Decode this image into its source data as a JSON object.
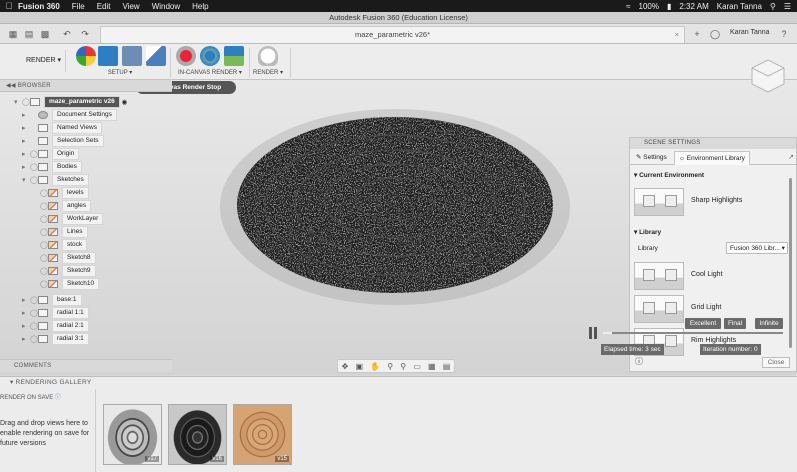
{
  "menubar": {
    "app_name": "Fusion 360",
    "items": [
      "File",
      "Edit",
      "View",
      "Window",
      "Help"
    ],
    "battery": "100%",
    "time": "2:32 AM",
    "user": "Karan Tanna"
  },
  "window_title": "Autodesk Fusion 360 (Education License)",
  "tabbar": {
    "doc_tab": "maze_parametric v26*",
    "user": "Karan Tanna"
  },
  "toolbar": {
    "workspace": "RENDER",
    "groups": [
      "SETUP",
      "IN-CANVAS RENDER",
      "RENDER"
    ]
  },
  "tooltip": "In-canvas Render Stop",
  "browser": {
    "title": "BROWSER",
    "root": "maze_parametric v26",
    "items": [
      {
        "label": "Document Settings",
        "icon": "gear-icon"
      },
      {
        "label": "Named Views",
        "icon": "folder-icon"
      },
      {
        "label": "Selection Sets",
        "icon": "folder-icon"
      },
      {
        "label": "Origin",
        "icon": "folder-icon"
      },
      {
        "label": "Bodies",
        "icon": "folder-icon"
      },
      {
        "label": "Sketches",
        "icon": "folder-icon"
      }
    ],
    "sketches": [
      "levels",
      "angles",
      "WorkLayer",
      "Lines",
      "stock",
      "Sketch8",
      "Sketch9",
      "Sketch10"
    ],
    "components": [
      "base:1",
      "radial 1:1",
      "radial 2:1",
      "radial 3:1"
    ]
  },
  "comments": "COMMENTS",
  "scene": {
    "title": "SCENE SETTINGS",
    "tabs": [
      "Settings",
      "Environment Library"
    ],
    "current_env_heading": "Current Environment",
    "current_env": "Sharp Highlights",
    "library_heading": "Library",
    "library_label": "Library",
    "library_value": "Fusion 360 Libr...",
    "environments": [
      "Cool Light",
      "Grid Light",
      "Rim Highlights"
    ],
    "close_label": "Close"
  },
  "render_progress": {
    "quality_levels": [
      "Excellent",
      "Final",
      "Infinite"
    ],
    "progress_fraction": 0.05,
    "elapsed": "Elapsed time: 3 sec",
    "iteration": "Iteration number: 0"
  },
  "gallery": {
    "title": "RENDERING GALLERY",
    "render_on_save": "RENDER ON SAVE",
    "instructions": "Drag and drop views here to enable rendering on save for future versions",
    "thumbnails": [
      {
        "version": "v17",
        "style": "silver"
      },
      {
        "version": "v16",
        "style": "dark"
      },
      {
        "version": "v15",
        "style": "wood"
      }
    ]
  },
  "colors": {
    "viewport_bg": "#e0e0e0",
    "menubar_bg": "#1a1a1a",
    "tooltip_bg": "#555555",
    "wood": "#c9976a"
  }
}
